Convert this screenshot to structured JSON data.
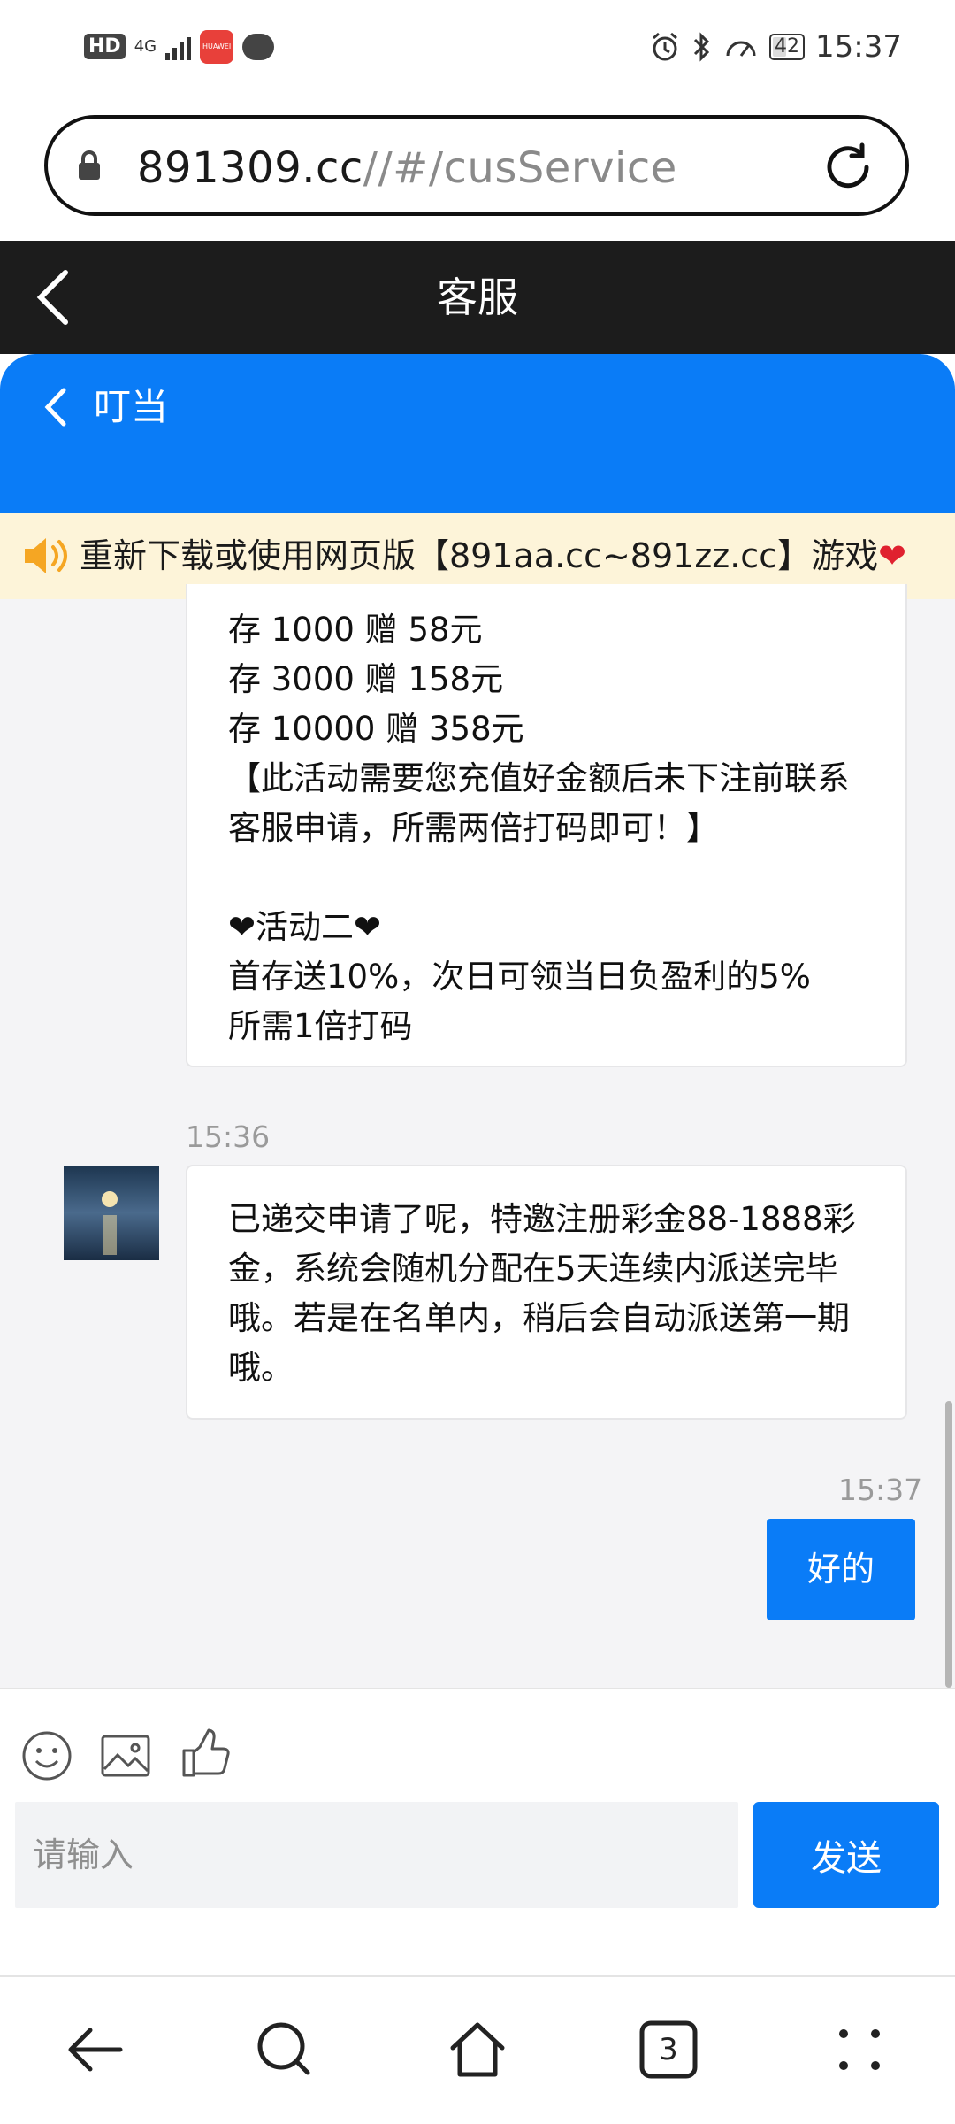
{
  "status_bar": {
    "hd": "HD",
    "network": "4G",
    "battery": "42",
    "time": "15:37"
  },
  "browser": {
    "url_host": "891309.cc",
    "url_path": "//#/cusService",
    "tabs_count": "3"
  },
  "page_header": {
    "title": "客服"
  },
  "chat_header": {
    "agent_name": "叮当"
  },
  "notice": {
    "text": "重新下载或使用网页版【891aa.cc~891zz.cc】游戏"
  },
  "messages": [
    {
      "from": "agent",
      "text": "存 1000 赠 58元\n存 3000 赠 158元\n存 10000 赠 358元\n【此活动需要您充值好金额后未下注前联系客服申请，所需两倍打码即可！】\n\n❤活动二❤\n首存送10%，次日可领当日负盈利的5%\n所需1倍打码"
    },
    {
      "from": "agent",
      "time": "15:36",
      "text": "已递交申请了呢，特邀注册彩金88-1888彩金，系统会随机分配在5天连续内派送完毕哦。若是在名单内，稍后会自动派送第一期哦。"
    },
    {
      "from": "user",
      "time": "15:37",
      "text": "好的"
    }
  ],
  "composer": {
    "placeholder": "请输入",
    "send_label": "发送"
  },
  "colors": {
    "primary": "#0a7cf7",
    "header_dark": "#1c1c1c",
    "notice_bg": "#fdf4d9",
    "chat_bg": "#f4f4f6",
    "heart": "#e0212f"
  }
}
